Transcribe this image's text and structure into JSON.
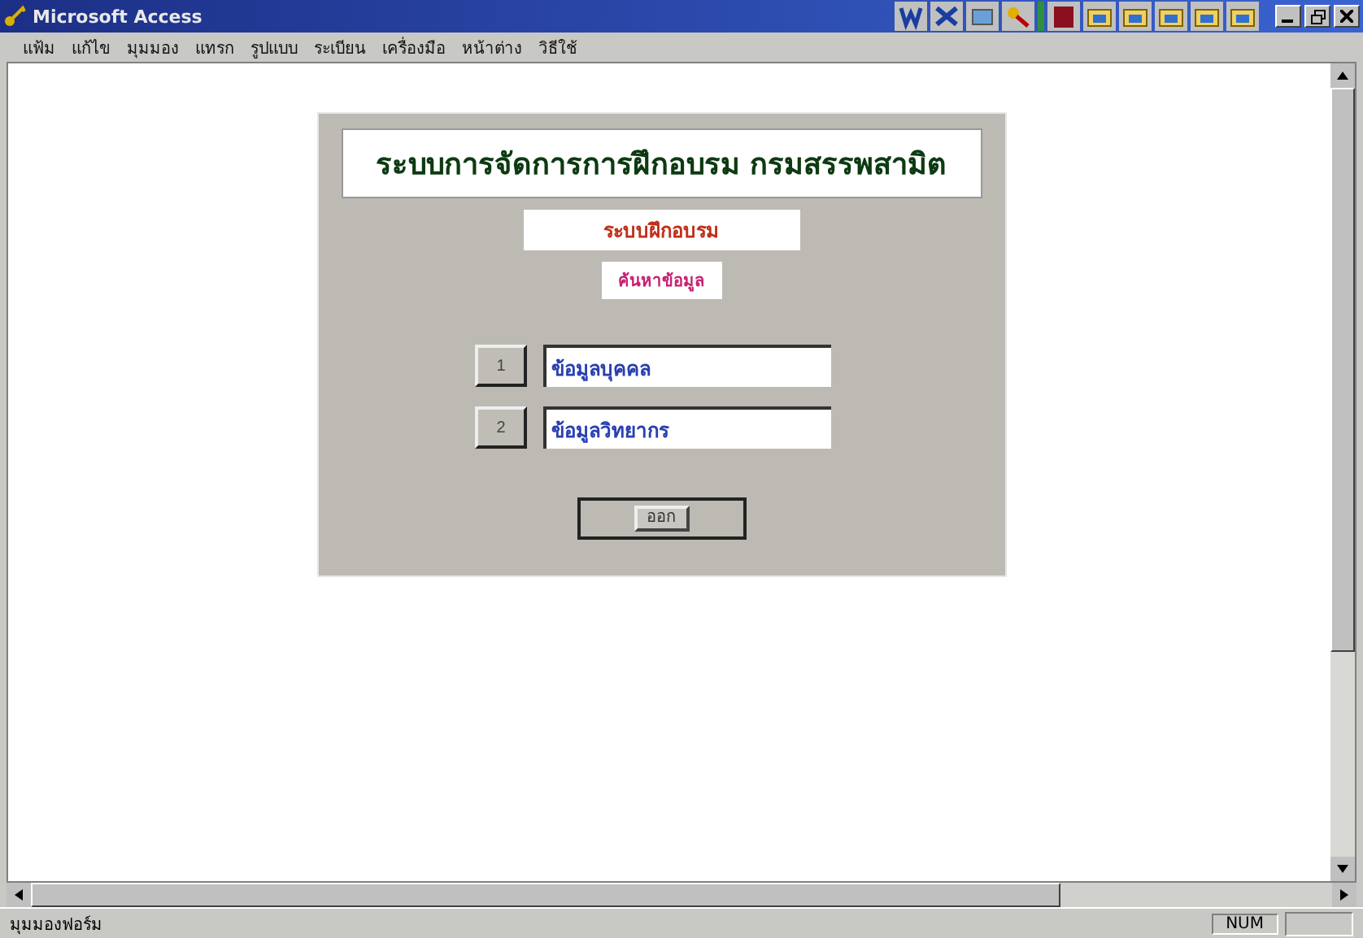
{
  "window": {
    "title": "Microsoft Access"
  },
  "menu": [
    "แฟ้ม",
    "แก้ไข",
    "มุมมอง",
    "แทรก",
    "รูปแบบ",
    "ระเบียน",
    "เครื่องมือ",
    "หน้าต่าง",
    "วิธีใช้"
  ],
  "form": {
    "title": "ระบบการจัดการการฝึกอบรม กรมสรรพสามิต",
    "subtitle": "ระบบฝึกอบรม",
    "section": "ค้นหาข้อมูล",
    "options": [
      {
        "key": "1",
        "label": "ข้อมูลบุคคล"
      },
      {
        "key": "2",
        "label": "ข้อมูลวิทยากร"
      }
    ],
    "exit_button": "ออก"
  },
  "status_bar": {
    "message": "มุมมองฟอร์ม",
    "indicator": "NUM"
  }
}
